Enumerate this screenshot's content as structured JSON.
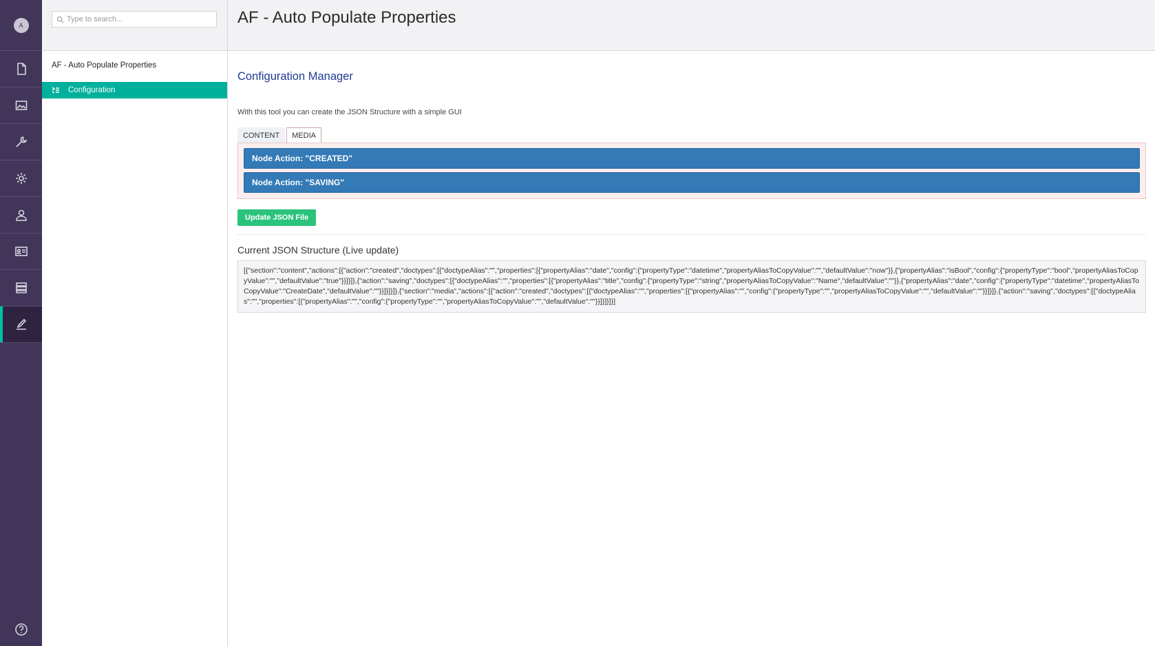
{
  "user": {
    "avatar_initial": "A"
  },
  "sections": [
    {
      "icon": "document-icon",
      "name": "Content"
    },
    {
      "icon": "image-icon",
      "name": "Media"
    },
    {
      "icon": "wrench-icon",
      "name": "Settings"
    },
    {
      "icon": "gear-icon",
      "name": "Developer"
    },
    {
      "icon": "user-icon",
      "name": "Users"
    },
    {
      "icon": "id-card-icon",
      "name": "Members"
    },
    {
      "icon": "forms-icon",
      "name": "Forms"
    },
    {
      "icon": "edit-icon",
      "name": "AF Auto Populate",
      "active": true
    }
  ],
  "search": {
    "placeholder": "Type to search..."
  },
  "tree": {
    "root_label": "AF - Auto Populate Properties",
    "selected_item": "Configuration"
  },
  "header": {
    "title": "AF - Auto Populate Properties"
  },
  "main": {
    "heading": "Configuration Manager",
    "intro": "With this tool you can create the JSON Structure with a simple GUI",
    "tabs": [
      {
        "label": "CONTENT",
        "active": false
      },
      {
        "label": "MEDIA",
        "active": true
      }
    ],
    "actions": [
      "Node Action: \"CREATED\"",
      "Node Action: \"SAVING\""
    ],
    "update_button": "Update JSON File",
    "json_title": "Current JSON Structure (Live update)",
    "json_text": "[{\"section\":\"content\",\"actions\":[{\"action\":\"created\",\"doctypes\":[{\"doctypeAlias\":\"\",\"properties\":[{\"propertyAlias\":\"date\",\"config\":{\"propertyType\":\"datetime\",\"propertyAliasToCopyValue\":\"\",\"defaultValue\":\"now\"}},{\"propertyAlias\":\"isBool\",\"config\":{\"propertyType\":\"bool\",\"propertyAliasToCopyValue\":\"\",\"defaultValue\":\"true\"}}]}]},{\"action\":\"saving\",\"doctypes\":[{\"doctypeAlias\":\"\",\"properties\":[{\"propertyAlias\":\"title\",\"config\":{\"propertyType\":\"string\",\"propertyAliasToCopyValue\":\"Name\",\"defaultValue\":\"\"}},{\"propertyAlias\":\"date\",\"config\":{\"propertyType\":\"datetime\",\"propertyAliasToCopyValue\":\"CreateDate\",\"defaultValue\":\"\"}}]}]}]},{\"section\":\"media\",\"actions\":[{\"action\":\"created\",\"doctypes\":[{\"doctypeAlias\":\"\",\"properties\":[{\"propertyAlias\":\"\",\"config\":{\"propertyType\":\"\",\"propertyAliasToCopyValue\":\"\",\"defaultValue\":\"\"}}]}]},{\"action\":\"saving\",\"doctypes\":[{\"doctypeAlias\":\"\",\"properties\":[{\"propertyAlias\":\"\",\"config\":{\"propertyType\":\"\",\"propertyAliasToCopyValue\":\"\",\"defaultValue\":\"\"}}]}]}]}]"
  },
  "colors": {
    "rail": "#413659",
    "accent": "#00b09b",
    "action_blue": "#337ab7",
    "update_green": "#2bc37c",
    "heading_blue": "#1f3a93"
  }
}
